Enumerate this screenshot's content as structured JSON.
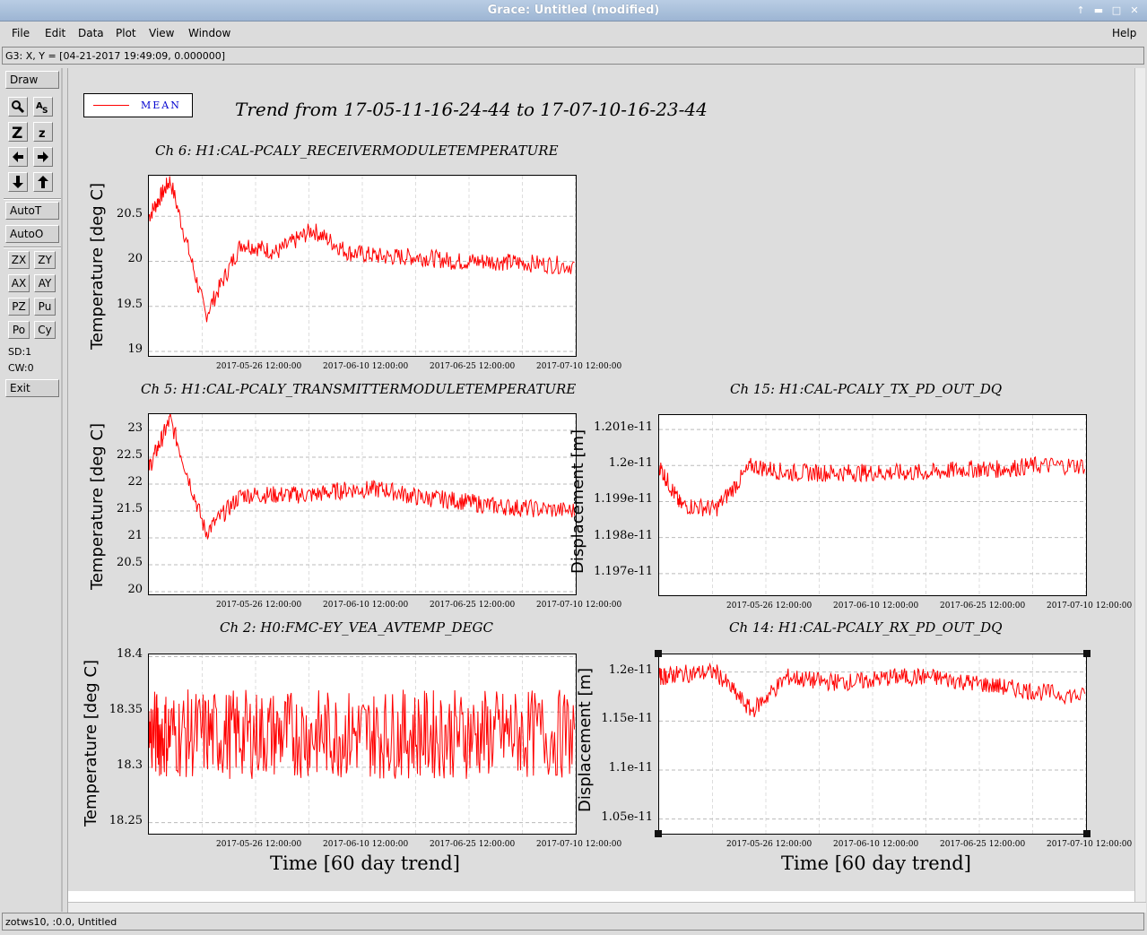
{
  "window": {
    "title": "Grace: Untitled (modified)"
  },
  "menu": {
    "file": "File",
    "edit": "Edit",
    "data": "Data",
    "plot": "Plot",
    "view": "View",
    "window": "Window",
    "help": "Help"
  },
  "locator": "G3: X, Y = [04-21-2017 19:49:09, 0.000000]",
  "toolbar": {
    "draw": "Draw",
    "autot": "AutoT",
    "autoo": "AutoO",
    "zx": "ZX",
    "zy": "ZY",
    "ax": "AX",
    "ay": "AY",
    "pz": "PZ",
    "pu": "Pu",
    "po": "Po",
    "cy": "Cy",
    "sd": "SD:1",
    "cw": "CW:0",
    "exit": "Exit"
  },
  "status": "zotws10, :0.0, Untitled",
  "legend": {
    "label": "MEAN",
    "color": "#ff0000"
  },
  "main_title": "Trend from 17-05-11-16-24-44 to 17-07-10-16-23-44",
  "x_label": "Time [60 day trend]",
  "x_ticks": [
    "2017-05-26 12:00:00",
    "2017-06-10 12:00:00",
    "2017-06-25 12:00:00",
    "2017-07-10 12:00:00"
  ],
  "chart_data": [
    {
      "type": "line",
      "title": "Ch 6: H1:CAL-PCALY_RECEIVERMODULETEMPERATURE",
      "ylabel": "Temperature [deg C]",
      "xlabel": "",
      "yticks": [
        "20.5",
        "20",
        "19.5",
        "19"
      ],
      "ylim": [
        18.95,
        20.95
      ],
      "series": [
        {
          "name": "MEAN",
          "color": "#ff0000"
        }
      ],
      "x": [
        "2017-05-11",
        "2017-05-14",
        "2017-05-19",
        "2017-05-24",
        "2017-05-29",
        "2017-06-03",
        "2017-06-08",
        "2017-06-13",
        "2017-06-18",
        "2017-06-23",
        "2017-06-28",
        "2017-07-03",
        "2017-07-10"
      ],
      "values": [
        20.5,
        20.9,
        19.4,
        20.2,
        20.1,
        20.35,
        20.1,
        20.05,
        20.05,
        20.0,
        20.0,
        19.98,
        19.95
      ]
    },
    {
      "type": "line",
      "title": "Ch 5: H1:CAL-PCALY_TRANSMITTERMODULETEMPERATURE",
      "ylabel": "Temperature [deg C]",
      "xlabel": "",
      "yticks": [
        "23",
        "22.5",
        "22",
        "21.5",
        "21",
        "20.5",
        "20"
      ],
      "ylim": [
        19.95,
        23.3
      ],
      "series": [
        {
          "name": "MEAN",
          "color": "#ff0000"
        }
      ],
      "x": [
        "2017-05-11",
        "2017-05-14",
        "2017-05-19",
        "2017-05-24",
        "2017-05-29",
        "2017-06-03",
        "2017-06-08",
        "2017-06-13",
        "2017-06-18",
        "2017-06-23",
        "2017-06-28",
        "2017-07-03",
        "2017-07-10"
      ],
      "values": [
        22.3,
        23.2,
        21.1,
        21.8,
        21.8,
        21.8,
        21.9,
        21.9,
        21.75,
        21.7,
        21.6,
        21.55,
        21.5
      ]
    },
    {
      "type": "line",
      "title": "Ch 15: H1:CAL-PCALY_TX_PD_OUT_DQ",
      "ylabel": "Displacement [m]",
      "xlabel": "",
      "yticks": [
        "1.201e-11",
        "1.2e-11",
        "1.199e-11",
        "1.198e-11",
        "1.197e-11"
      ],
      "ylim": [
        1.1964e-11,
        1.2014e-11
      ],
      "series": [
        {
          "name": "MEAN",
          "color": "#ff0000"
        }
      ],
      "x": [
        "2017-05-11",
        "2017-05-14",
        "2017-05-19",
        "2017-05-24",
        "2017-05-29",
        "2017-06-03",
        "2017-06-08",
        "2017-06-13",
        "2017-06-18",
        "2017-06-23",
        "2017-06-28",
        "2017-07-03",
        "2017-07-10"
      ],
      "values": [
        1.2e-11,
        1.1989e-11,
        1.1988e-11,
        1.2e-11,
        1.1998e-11,
        1.1998e-11,
        1.1998e-11,
        1.1998e-11,
        1.1998e-11,
        1.1999e-11,
        1.1999e-11,
        1.2e-11,
        1.2e-11
      ]
    },
    {
      "type": "line",
      "title": "Ch 2: H0:FMC-EY_VEA_AVTEMP_DEGC",
      "ylabel": "Temperature [deg C]",
      "xlabel": "Time [60 day trend]",
      "yticks": [
        "18.4",
        "18.35",
        "18.3",
        "18.25"
      ],
      "ylim": [
        18.24,
        18.402
      ],
      "series": [
        {
          "name": "MEAN",
          "color": "#ff0000"
        }
      ],
      "x": [
        "2017-05-11",
        "2017-05-14",
        "2017-05-19",
        "2017-05-24",
        "2017-05-29",
        "2017-06-03",
        "2017-06-08",
        "2017-06-13",
        "2017-06-18",
        "2017-06-23",
        "2017-06-28",
        "2017-07-03",
        "2017-07-10"
      ],
      "values": [
        18.33,
        18.33,
        18.33,
        18.33,
        18.33,
        18.33,
        18.33,
        18.33,
        18.33,
        18.33,
        18.33,
        18.33,
        18.33
      ]
    },
    {
      "type": "line",
      "title": "Ch 14: H1:CAL-PCALY_RX_PD_OUT_DQ",
      "ylabel": "Displacement [m]",
      "xlabel": "Time [60 day trend]",
      "yticks": [
        "1.2e-11",
        "1.15e-11",
        "1.1e-11",
        "1.05e-11"
      ],
      "ylim": [
        1.035e-11,
        1.218e-11
      ],
      "series": [
        {
          "name": "MEAN",
          "color": "#ff0000"
        }
      ],
      "x": [
        "2017-05-11",
        "2017-05-14",
        "2017-05-19",
        "2017-05-24",
        "2017-05-29",
        "2017-06-03",
        "2017-06-08",
        "2017-06-13",
        "2017-06-18",
        "2017-06-23",
        "2017-06-28",
        "2017-07-03",
        "2017-07-10"
      ],
      "values": [
        1.195e-11,
        1.198e-11,
        1.2e-11,
        1.16e-11,
        1.195e-11,
        1.19e-11,
        1.19e-11,
        1.195e-11,
        1.195e-11,
        1.19e-11,
        1.185e-11,
        1.18e-11,
        1.175e-11
      ]
    }
  ]
}
